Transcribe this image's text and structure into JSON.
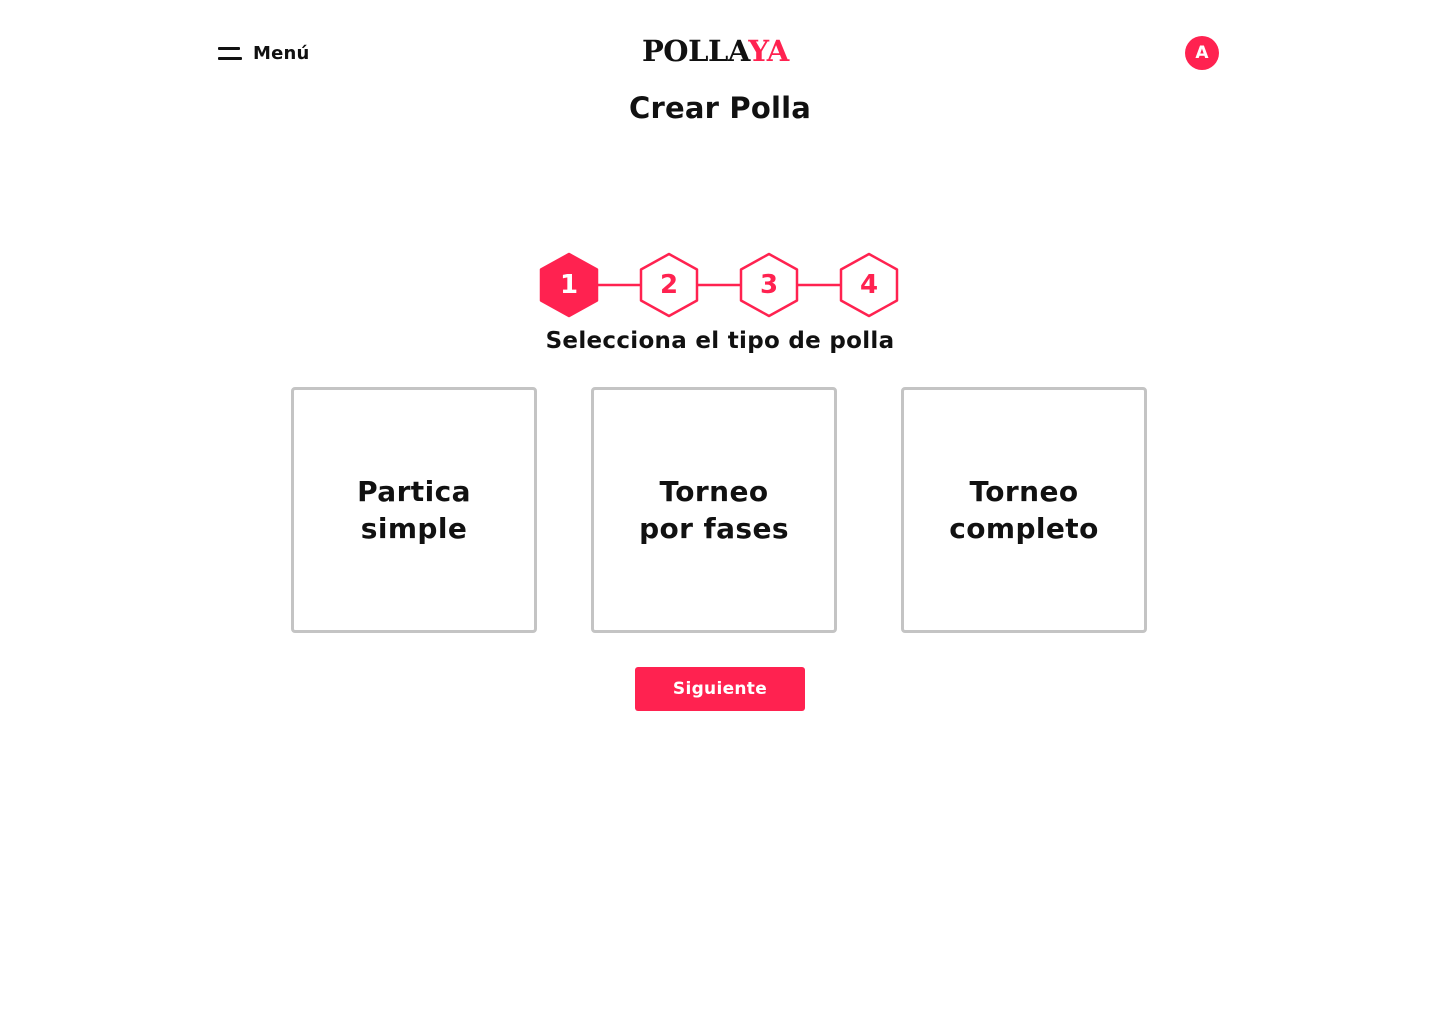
{
  "header": {
    "menu_label": "Menú",
    "logo_part1": "POLLA",
    "logo_part2": "YA",
    "avatar_initial": "A"
  },
  "page_title": "Crear Polla",
  "stepper": {
    "current_step": 1,
    "steps": [
      "1",
      "2",
      "3",
      "4"
    ]
  },
  "subtitle": "Selecciona el tipo de polla",
  "options": [
    {
      "line1": "Partica",
      "line2": "simple"
    },
    {
      "line1": "Torneo",
      "line2": "por fases"
    },
    {
      "line1": "Torneo",
      "line2": "completo"
    }
  ],
  "next_button_label": "Siguiente",
  "colors": {
    "accent": "#ff2250",
    "text": "#111111",
    "card_border": "#c4c4c4",
    "background": "#ffffff"
  }
}
